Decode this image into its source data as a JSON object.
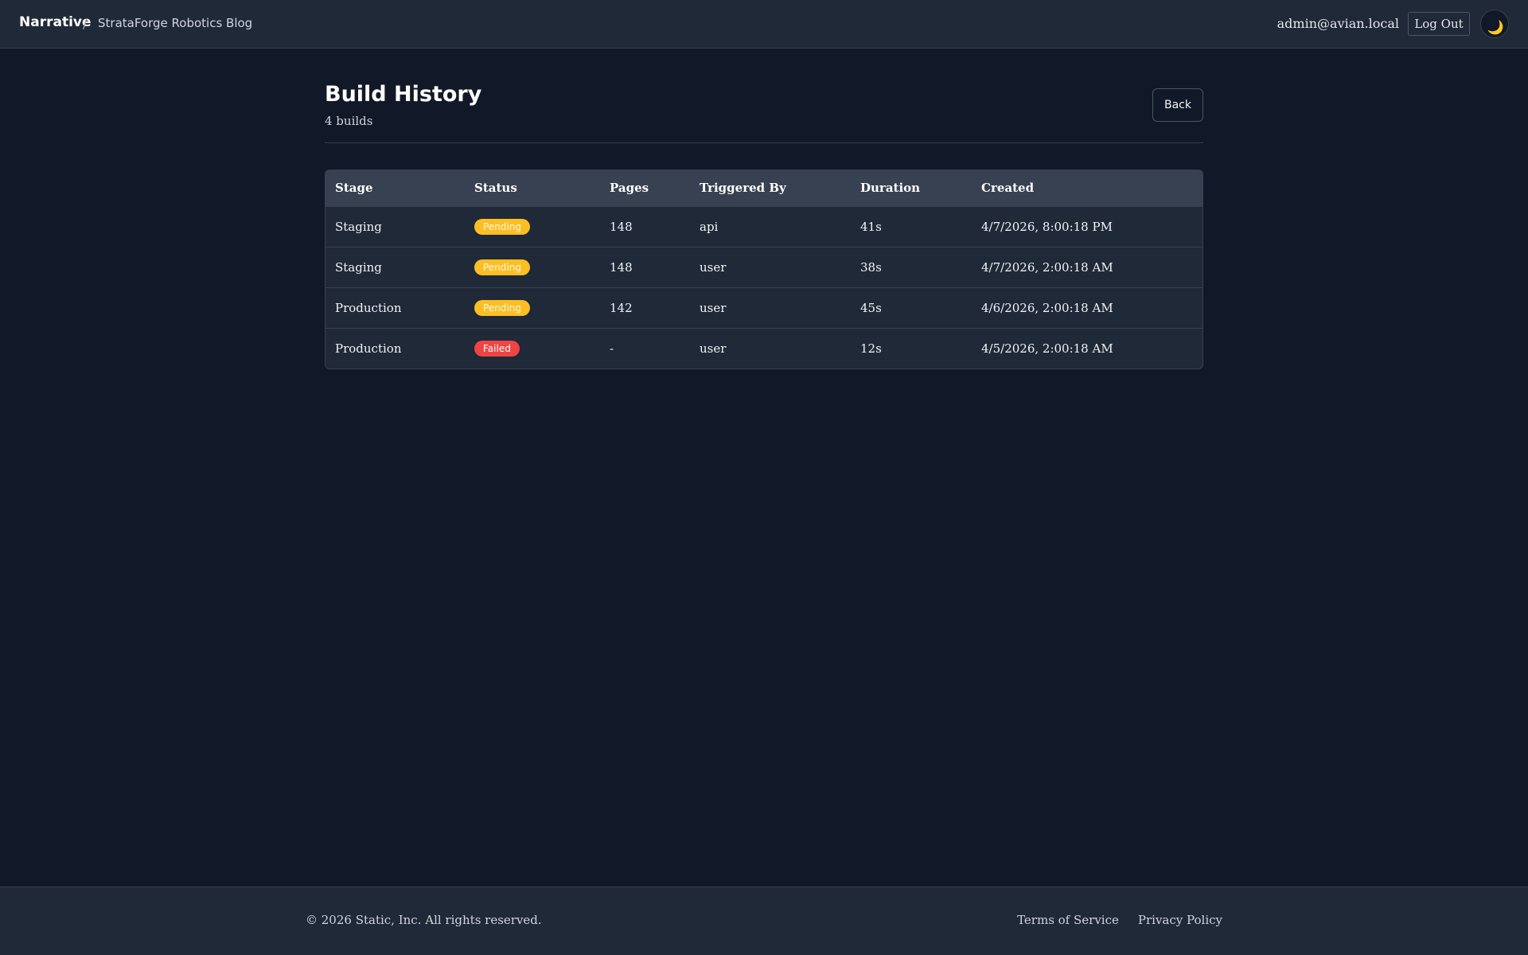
{
  "header": {
    "brand": "Narrative",
    "separator": "/",
    "site_name": "StrataForge Robotics Blog",
    "user_email": "admin@avian.local",
    "logout_label": "Log Out",
    "theme_icon": "moon-icon",
    "theme_glyph": "🌙"
  },
  "main": {
    "title": "Build History",
    "count_text": "4 builds",
    "back_label": "Back"
  },
  "table": {
    "columns": [
      "Stage",
      "Status",
      "Pages",
      "Triggered By",
      "Duration",
      "Created"
    ],
    "rows": [
      {
        "stage": "Staging",
        "status": "Pending",
        "pages": "148",
        "triggered_by": "api",
        "duration": "41s",
        "created": "4/7/2026, 8:00:18 PM"
      },
      {
        "stage": "Staging",
        "status": "Pending",
        "pages": "148",
        "triggered_by": "user",
        "duration": "38s",
        "created": "4/7/2026, 2:00:18 AM"
      },
      {
        "stage": "Production",
        "status": "Pending",
        "pages": "142",
        "triggered_by": "user",
        "duration": "45s",
        "created": "4/6/2026, 2:00:18 AM"
      },
      {
        "stage": "Production",
        "status": "Failed",
        "pages": "-",
        "triggered_by": "user",
        "duration": "12s",
        "created": "4/5/2026, 2:00:18 AM"
      }
    ]
  },
  "footer": {
    "copyright": "© 2026 Static, Inc. All rights reserved.",
    "terms_label": "Terms of Service",
    "privacy_label": "Privacy Policy"
  },
  "colors": {
    "background": "#111827",
    "surface": "#1f2937",
    "pending": "#fbbf24",
    "failed": "#ef4444"
  }
}
